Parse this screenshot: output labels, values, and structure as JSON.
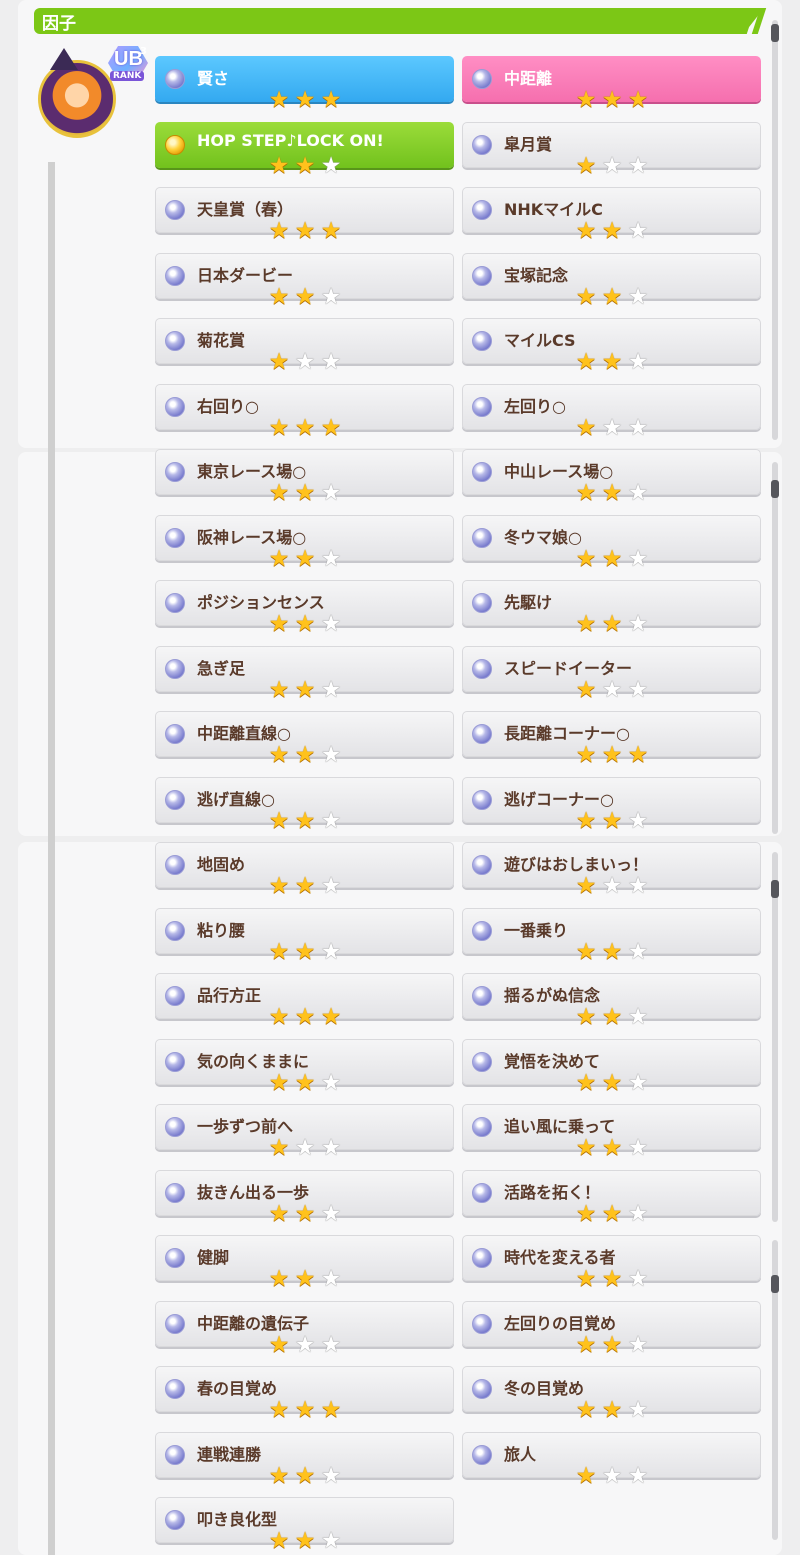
{
  "header": {
    "title": "因子"
  },
  "avatar": {
    "rank": "UB",
    "rank_sup": "3",
    "rank_label": "RANK"
  },
  "colors": {
    "accent": "#7cc716",
    "blue": "#33a9f0",
    "pink": "#f56fae",
    "green": "#72c21d",
    "star": "#ffc21c"
  },
  "factors": [
    {
      "label": "賢さ",
      "stars": 3,
      "type": "blue"
    },
    {
      "label": "中距離",
      "stars": 3,
      "type": "pink"
    },
    {
      "label": "HOP STEP♪LOCK ON!",
      "stars": 2,
      "type": "green"
    },
    {
      "label": "皐月賞",
      "stars": 1,
      "type": "white"
    },
    {
      "label": "天皇賞（春）",
      "stars": 3,
      "type": "white"
    },
    {
      "label": "NHKマイルC",
      "stars": 2,
      "type": "white"
    },
    {
      "label": "日本ダービー",
      "stars": 2,
      "type": "white"
    },
    {
      "label": "宝塚記念",
      "stars": 2,
      "type": "white"
    },
    {
      "label": "菊花賞",
      "stars": 1,
      "type": "white"
    },
    {
      "label": "マイルCS",
      "stars": 2,
      "type": "white"
    },
    {
      "label": "右回り○",
      "stars": 3,
      "type": "white"
    },
    {
      "label": "左回り○",
      "stars": 1,
      "type": "white"
    },
    {
      "label": "東京レース場○",
      "stars": 2,
      "type": "white"
    },
    {
      "label": "中山レース場○",
      "stars": 2,
      "type": "white"
    },
    {
      "label": "阪神レース場○",
      "stars": 2,
      "type": "white"
    },
    {
      "label": "冬ウマ娘○",
      "stars": 2,
      "type": "white"
    },
    {
      "label": "ポジションセンス",
      "stars": 2,
      "type": "white"
    },
    {
      "label": "先駆け",
      "stars": 2,
      "type": "white"
    },
    {
      "label": "急ぎ足",
      "stars": 2,
      "type": "white"
    },
    {
      "label": "スピードイーター",
      "stars": 1,
      "type": "white"
    },
    {
      "label": "中距離直線○",
      "stars": 2,
      "type": "white"
    },
    {
      "label": "長距離コーナー○",
      "stars": 3,
      "type": "white"
    },
    {
      "label": "逃げ直線○",
      "stars": 2,
      "type": "white"
    },
    {
      "label": "逃げコーナー○",
      "stars": 2,
      "type": "white"
    },
    {
      "label": "地固め",
      "stars": 2,
      "type": "white"
    },
    {
      "label": "遊びはおしまいっ！",
      "stars": 1,
      "type": "white"
    },
    {
      "label": "粘り腰",
      "stars": 2,
      "type": "white"
    },
    {
      "label": "一番乗り",
      "stars": 2,
      "type": "white"
    },
    {
      "label": "品行方正",
      "stars": 3,
      "type": "white"
    },
    {
      "label": "揺るがぬ信念",
      "stars": 2,
      "type": "white"
    },
    {
      "label": "気の向くままに",
      "stars": 2,
      "type": "white"
    },
    {
      "label": "覚悟を決めて",
      "stars": 2,
      "type": "white"
    },
    {
      "label": "一歩ずつ前へ",
      "stars": 1,
      "type": "white"
    },
    {
      "label": "追い風に乗って",
      "stars": 2,
      "type": "white"
    },
    {
      "label": "抜きん出る一歩",
      "stars": 2,
      "type": "white"
    },
    {
      "label": "活路を拓く！",
      "stars": 2,
      "type": "white"
    },
    {
      "label": "健脚",
      "stars": 2,
      "type": "white"
    },
    {
      "label": "時代を変える者",
      "stars": 2,
      "type": "white"
    },
    {
      "label": "中距離の遺伝子",
      "stars": 1,
      "type": "white"
    },
    {
      "label": "左回りの目覚め",
      "stars": 2,
      "type": "white"
    },
    {
      "label": "春の目覚め",
      "stars": 3,
      "type": "white"
    },
    {
      "label": "冬の目覚め",
      "stars": 2,
      "type": "white"
    },
    {
      "label": "連戦連勝",
      "stars": 2,
      "type": "white"
    },
    {
      "label": "旅人",
      "stars": 1,
      "type": "white"
    },
    {
      "label": "叩き良化型",
      "stars": 2,
      "type": "white"
    }
  ]
}
